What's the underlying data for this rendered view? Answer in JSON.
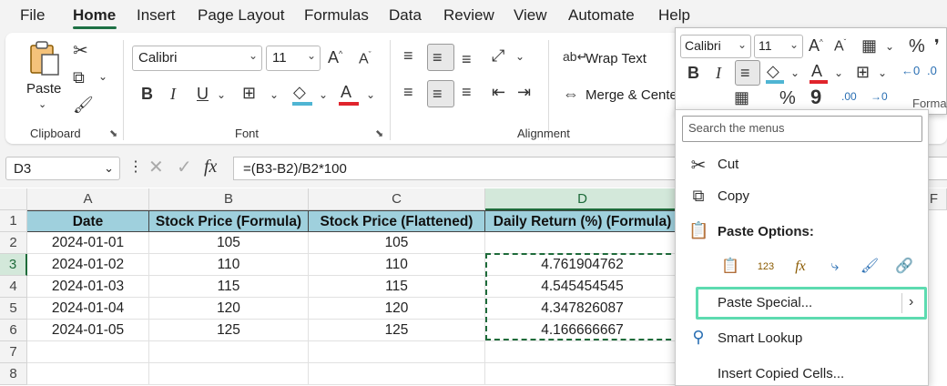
{
  "tabs": [
    "File",
    "Home",
    "Insert",
    "Page Layout",
    "Formulas",
    "Data",
    "Review",
    "View",
    "Automate",
    "Help"
  ],
  "ribbon": {
    "clipboard": {
      "paste_label": "Paste",
      "group_label": "Clipboard"
    },
    "font": {
      "font_name": "Calibri",
      "font_size": "11",
      "group_label": "Font",
      "bold": "B",
      "italic": "I",
      "underline": "U",
      "font_color": "#e0242c",
      "fill_color": "#4fb5d3"
    },
    "alignment": {
      "wrap_text": "Wrap Text",
      "merge_center": "Merge & Center",
      "group_label": "Alignment"
    }
  },
  "formula_bar": {
    "name_box": "D3",
    "fx": "fx",
    "formula": "=(B3-B2)/B2*100"
  },
  "sheet": {
    "columns": [
      "A",
      "B",
      "C",
      "D",
      "F"
    ],
    "rows": [
      "1",
      "2",
      "3",
      "4",
      "5",
      "6",
      "7",
      "8"
    ],
    "headers": [
      "Date",
      "Stock Price (Formula)",
      "Stock Price (Flattened)",
      "Daily Return (%) (Formula)"
    ],
    "data": [
      [
        "2024-01-01",
        "105",
        "105",
        ""
      ],
      [
        "2024-01-02",
        "110",
        "110",
        "4.761904762"
      ],
      [
        "2024-01-03",
        "115",
        "115",
        "4.545454545"
      ],
      [
        "2024-01-04",
        "120",
        "120",
        "4.347826087"
      ],
      [
        "2024-01-05",
        "125",
        "125",
        "4.166666667"
      ]
    ],
    "header_fill": "#9fd0dd"
  },
  "mini_toolbar": {
    "font_name": "Calibri",
    "font_size": "11",
    "bold": "B",
    "italic": "I",
    "percent": "%",
    "comma": "9",
    "format_label": "Forma"
  },
  "context_menu": {
    "search_placeholder": "Search the menus",
    "cut": "Cut",
    "copy": "Copy",
    "paste_options": "Paste Options:",
    "paste_special": "Paste Special...",
    "smart_lookup": "Smart Lookup",
    "insert_copied": "Insert Copied Cells...",
    "highlight_color": "#5ddbb0"
  }
}
